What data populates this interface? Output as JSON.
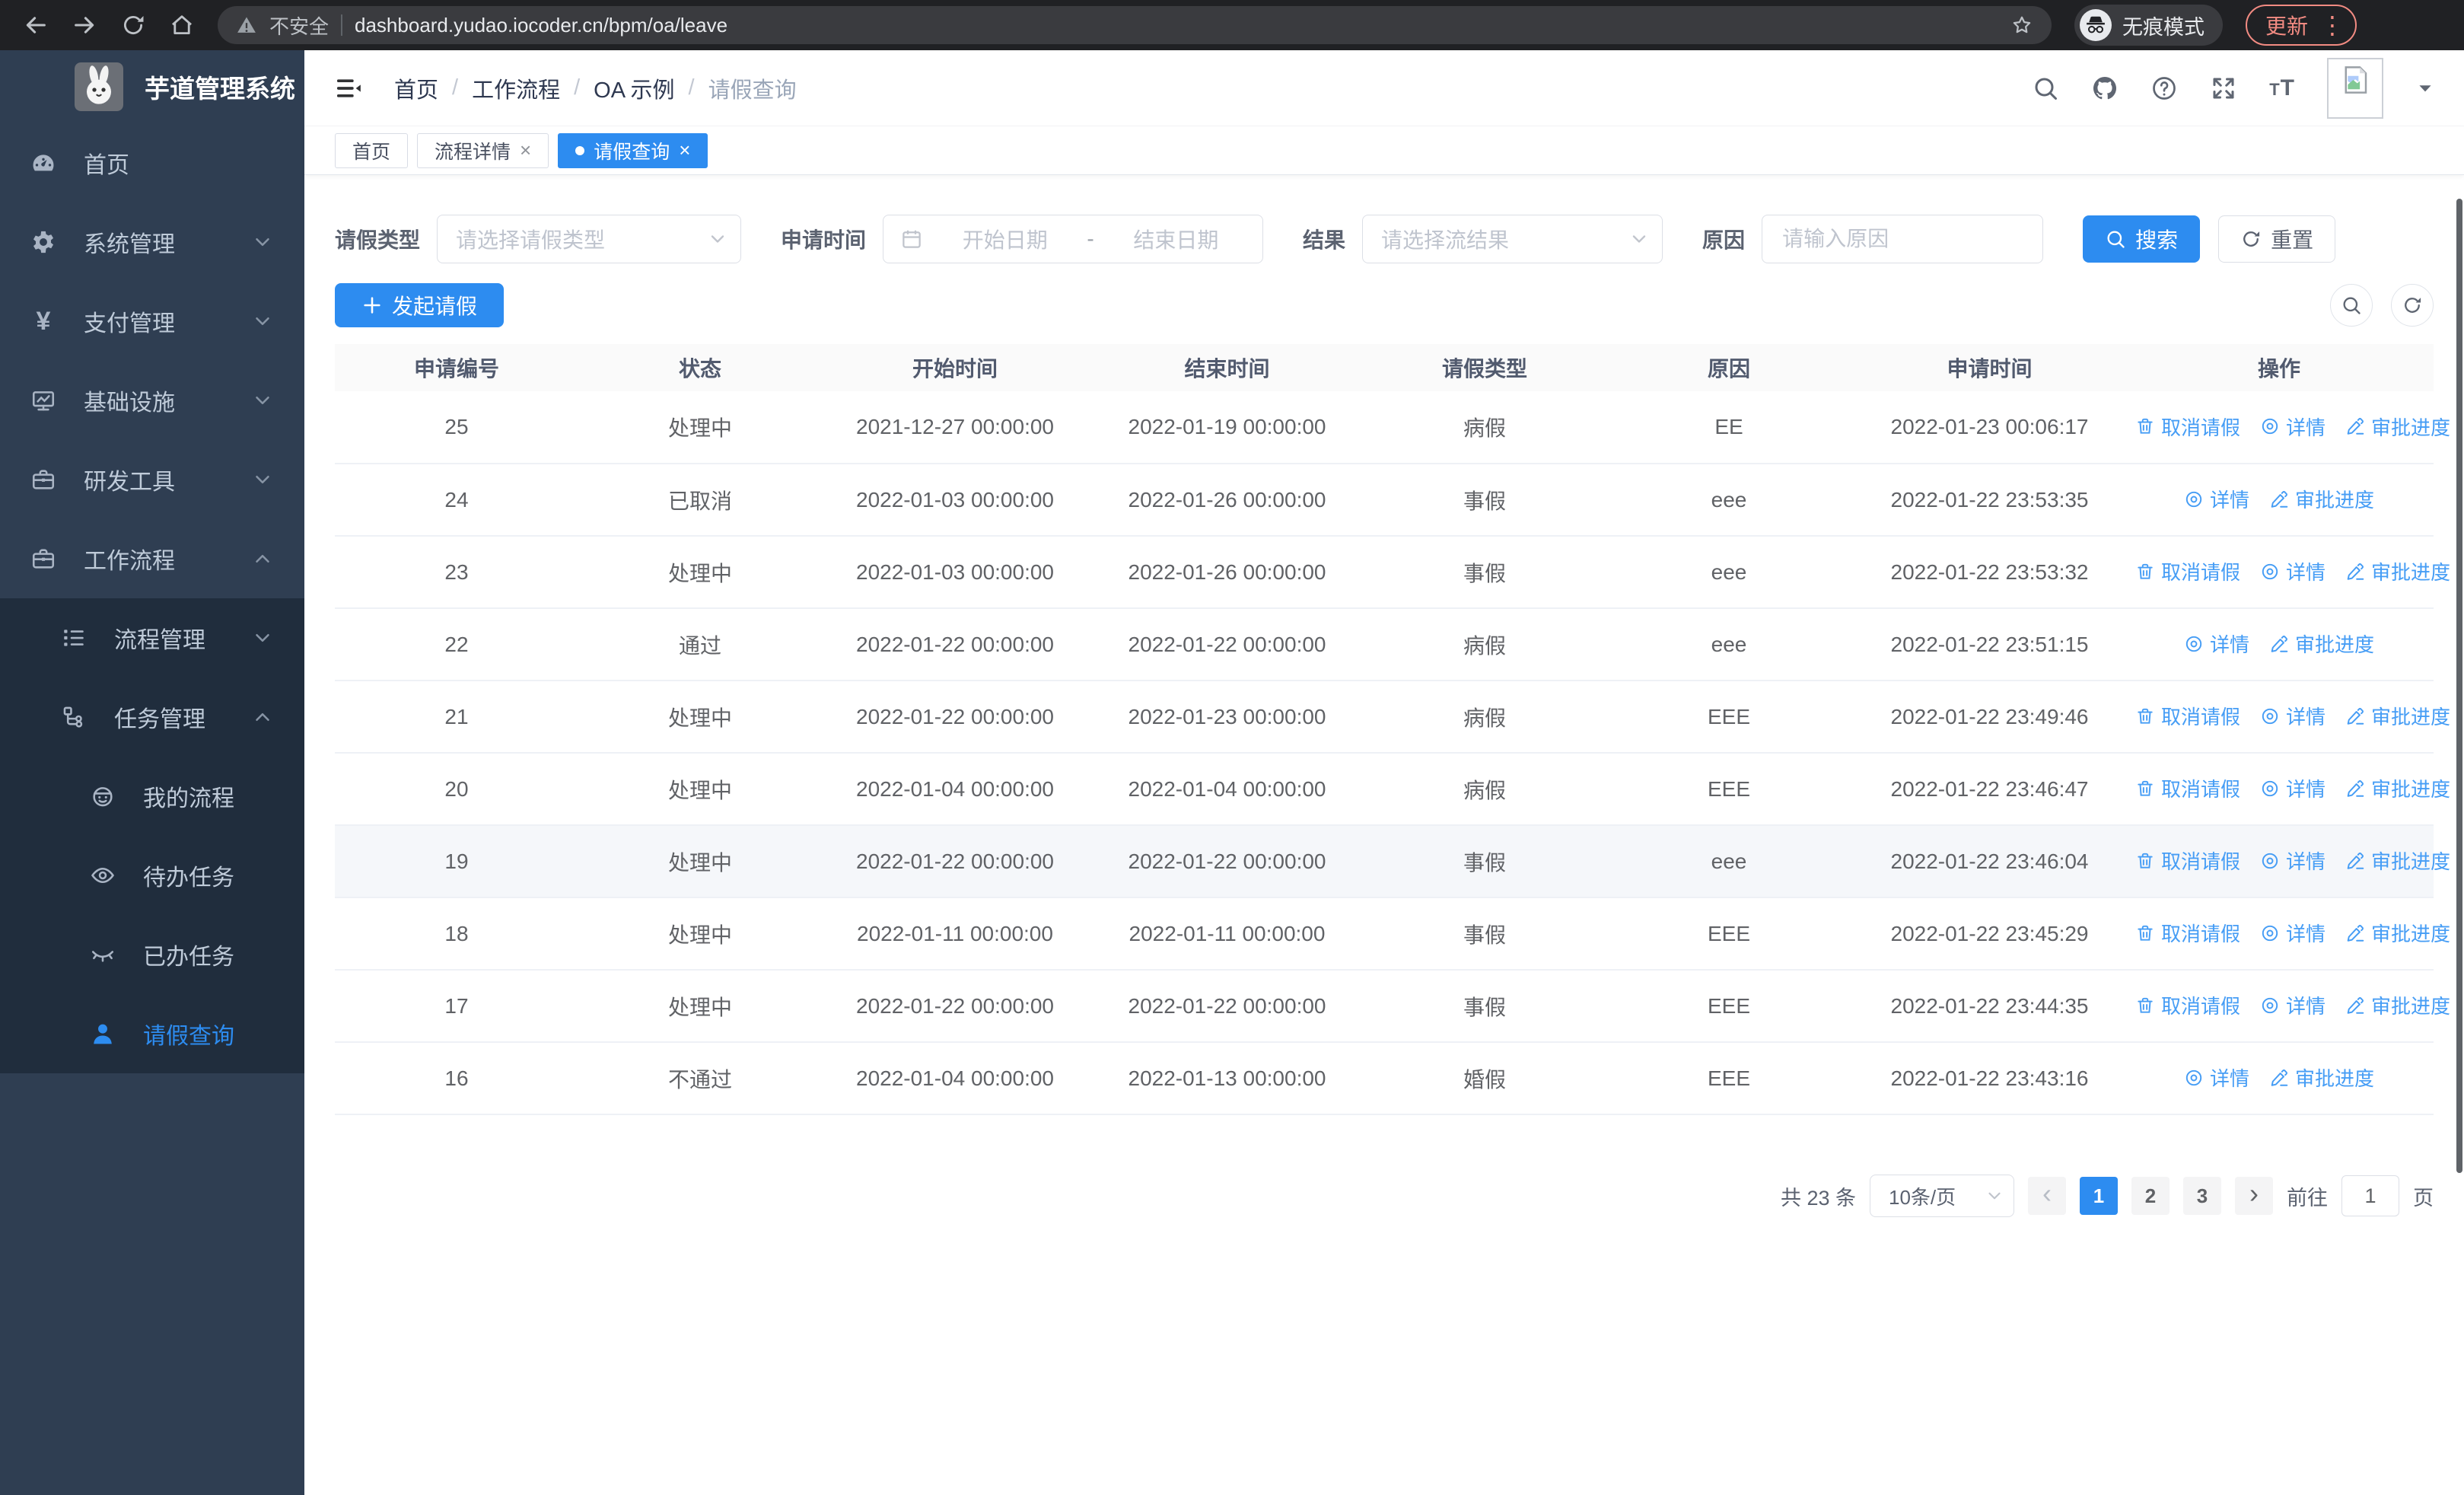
{
  "browser": {
    "security": "不安全",
    "url": "dashboard.yudao.iocoder.cn/bpm/oa/leave",
    "incognito": "无痕模式",
    "update": "更新",
    "menu_dots": "⋮"
  },
  "misc": {
    "close_glyph": "×",
    "breadcrumb_sep": "/"
  },
  "sidebar": {
    "title": "芋道管理系统",
    "items": [
      {
        "icon": "dashboard",
        "label": "首页"
      },
      {
        "icon": "gear",
        "label": "系统管理",
        "chevron": "down"
      },
      {
        "icon": "yen",
        "label": "支付管理",
        "chevron": "down"
      },
      {
        "icon": "monitor",
        "label": "基础设施",
        "chevron": "down"
      },
      {
        "icon": "briefcase",
        "label": "研发工具",
        "chevron": "down"
      },
      {
        "icon": "briefcase",
        "label": "工作流程",
        "chevron": "up",
        "children": [
          {
            "icon": "list",
            "label": "流程管理",
            "chevron": "down"
          },
          {
            "icon": "flow",
            "label": "任务管理",
            "chevron": "up",
            "children": [
              {
                "icon": "robot",
                "label": "我的流程"
              },
              {
                "icon": "eye",
                "label": "待办任务"
              },
              {
                "icon": "eye-closed",
                "label": "已办任务"
              },
              {
                "icon": "user",
                "label": "请假查询",
                "active": true
              }
            ]
          }
        ]
      }
    ]
  },
  "header": {
    "breadcrumb": [
      "首页",
      "工作流程",
      "OA 示例",
      "请假查询"
    ]
  },
  "tabs": [
    {
      "label": "首页",
      "closable": false,
      "active": false
    },
    {
      "label": "流程详情",
      "closable": true,
      "active": false
    },
    {
      "label": "请假查询",
      "closable": true,
      "active": true
    }
  ],
  "filters": {
    "leave_type": {
      "label": "请假类型",
      "placeholder": "请选择请假类型"
    },
    "apply_time": {
      "label": "申请时间",
      "start_placeholder": "开始日期",
      "separator": "-",
      "end_placeholder": "结束日期"
    },
    "result": {
      "label": "结果",
      "placeholder": "请选择流结果"
    },
    "reason": {
      "label": "原因",
      "placeholder": "请输入原因"
    },
    "search_label": "搜索",
    "reset_label": "重置"
  },
  "toolbar": {
    "create_label": "发起请假"
  },
  "table": {
    "columns": [
      "申请编号",
      "状态",
      "开始时间",
      "结束时间",
      "请假类型",
      "原因",
      "申请时间",
      "操作"
    ],
    "action_labels": {
      "cancel": "取消请假",
      "detail": "详情",
      "progress": "审批进度"
    },
    "rows": [
      {
        "id": "25",
        "status": "处理中",
        "start": "2021-12-27 00:00:00",
        "end": "2022-01-19 00:00:00",
        "type": "病假",
        "reason": "EE",
        "applied": "2022-01-23 00:06:17",
        "actions": [
          "cancel",
          "detail",
          "progress"
        ],
        "highlight": false
      },
      {
        "id": "24",
        "status": "已取消",
        "start": "2022-01-03 00:00:00",
        "end": "2022-01-26 00:00:00",
        "type": "事假",
        "reason": "eee",
        "applied": "2022-01-22 23:53:35",
        "actions": [
          "detail",
          "progress"
        ],
        "highlight": false
      },
      {
        "id": "23",
        "status": "处理中",
        "start": "2022-01-03 00:00:00",
        "end": "2022-01-26 00:00:00",
        "type": "事假",
        "reason": "eee",
        "applied": "2022-01-22 23:53:32",
        "actions": [
          "cancel",
          "detail",
          "progress"
        ],
        "highlight": false
      },
      {
        "id": "22",
        "status": "通过",
        "start": "2022-01-22 00:00:00",
        "end": "2022-01-22 00:00:00",
        "type": "病假",
        "reason": "eee",
        "applied": "2022-01-22 23:51:15",
        "actions": [
          "detail",
          "progress"
        ],
        "highlight": false
      },
      {
        "id": "21",
        "status": "处理中",
        "start": "2022-01-22 00:00:00",
        "end": "2022-01-23 00:00:00",
        "type": "病假",
        "reason": "EEE",
        "applied": "2022-01-22 23:49:46",
        "actions": [
          "cancel",
          "detail",
          "progress"
        ],
        "highlight": false
      },
      {
        "id": "20",
        "status": "处理中",
        "start": "2022-01-04 00:00:00",
        "end": "2022-01-04 00:00:00",
        "type": "病假",
        "reason": "EEE",
        "applied": "2022-01-22 23:46:47",
        "actions": [
          "cancel",
          "detail",
          "progress"
        ],
        "highlight": false
      },
      {
        "id": "19",
        "status": "处理中",
        "start": "2022-01-22 00:00:00",
        "end": "2022-01-22 00:00:00",
        "type": "事假",
        "reason": "eee",
        "applied": "2022-01-22 23:46:04",
        "actions": [
          "cancel",
          "detail",
          "progress"
        ],
        "highlight": true
      },
      {
        "id": "18",
        "status": "处理中",
        "start": "2022-01-11 00:00:00",
        "end": "2022-01-11 00:00:00",
        "type": "事假",
        "reason": "EEE",
        "applied": "2022-01-22 23:45:29",
        "actions": [
          "cancel",
          "detail",
          "progress"
        ],
        "highlight": false
      },
      {
        "id": "17",
        "status": "处理中",
        "start": "2022-01-22 00:00:00",
        "end": "2022-01-22 00:00:00",
        "type": "事假",
        "reason": "EEE",
        "applied": "2022-01-22 23:44:35",
        "actions": [
          "cancel",
          "detail",
          "progress"
        ],
        "highlight": false
      },
      {
        "id": "16",
        "status": "不通过",
        "start": "2022-01-04 00:00:00",
        "end": "2022-01-13 00:00:00",
        "type": "婚假",
        "reason": "EEE",
        "applied": "2022-01-22 23:43:16",
        "actions": [
          "detail",
          "progress"
        ],
        "highlight": false
      }
    ]
  },
  "pagination": {
    "total": "共 23 条",
    "page_size": "10条/页",
    "prev": "‹",
    "next": "›",
    "pages": [
      "1",
      "2",
      "3"
    ],
    "active": "1",
    "goto_label": "前往",
    "goto_value": "1",
    "unit": "页"
  },
  "colors": {
    "accent": "#2d8cf0",
    "link": "#469df5",
    "sidebar_bg": "#2f3e52",
    "submenu_bg": "#202d3d",
    "update": "#f28b82",
    "browser_bar": "#202124",
    "row_highlight": "#f5f7fa"
  }
}
